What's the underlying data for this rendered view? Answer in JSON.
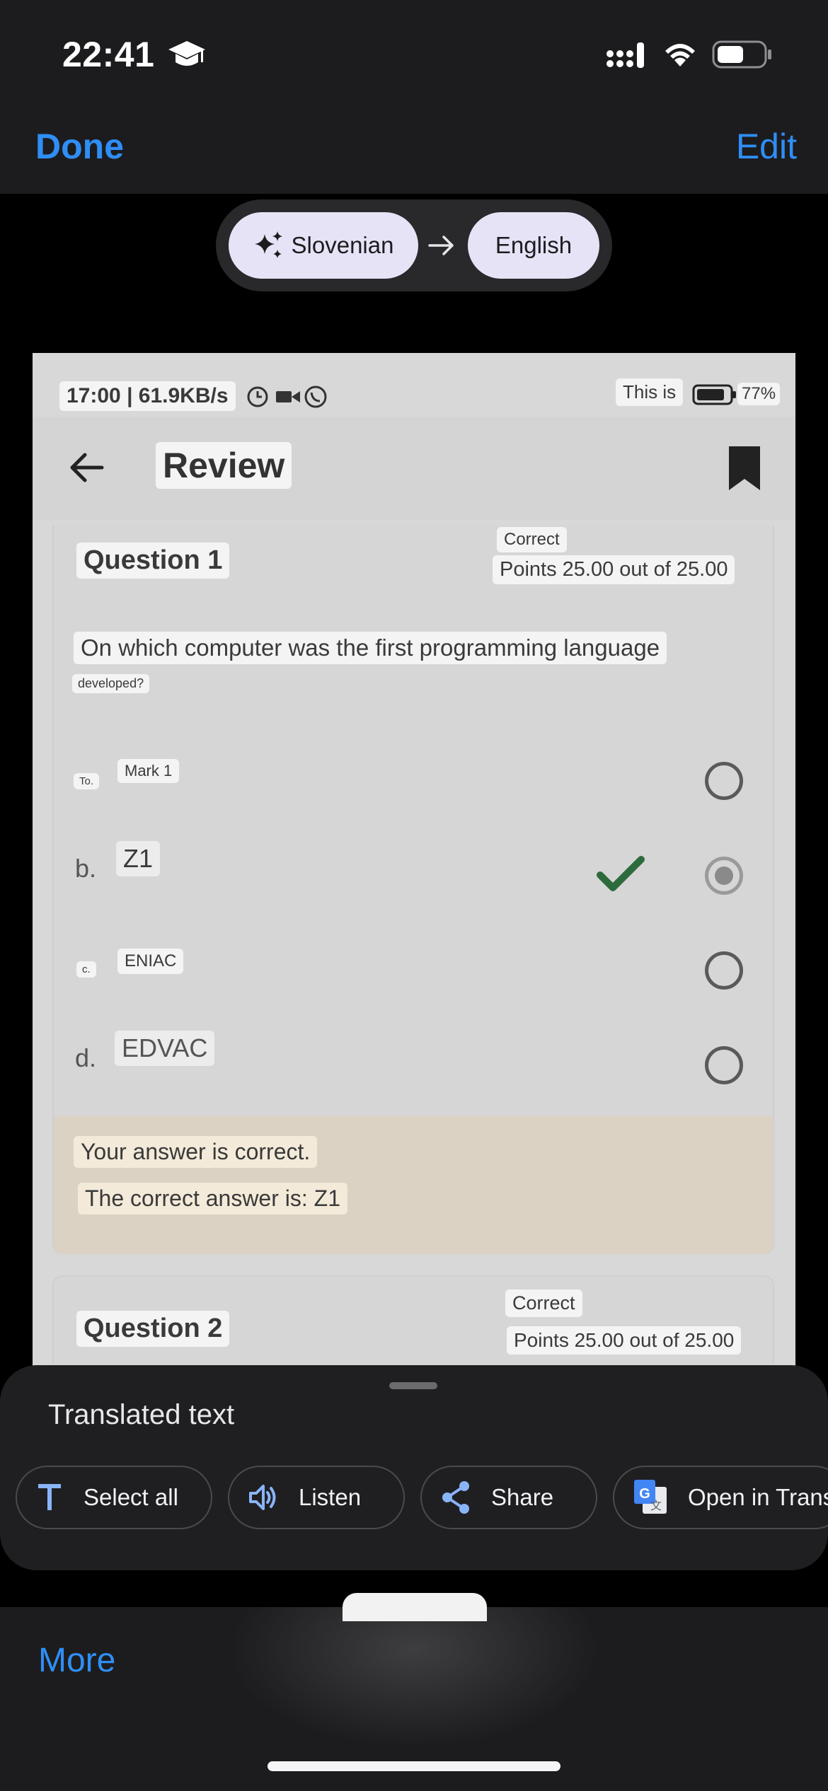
{
  "status_bar": {
    "time": "22:41"
  },
  "nav": {
    "done": "Done",
    "edit": "Edit"
  },
  "language": {
    "source": "Slovenian",
    "target": "English"
  },
  "image": {
    "status": {
      "time_speed": "17:00 | 61.9KB/s",
      "carrier": "This is",
      "battery": "77%"
    },
    "appbar": {
      "title": "Review"
    },
    "question1": {
      "title": "Question 1",
      "status": "Correct",
      "points": "Points 25.00 out of 25.00",
      "text_line1": "On which computer was the first programming language",
      "text_line2": "developed?",
      "options": [
        {
          "letter": "To.",
          "label": "Mark 1"
        },
        {
          "letter": "b.",
          "label": "Z1"
        },
        {
          "letter": "c.",
          "label": "ENIAC"
        },
        {
          "letter": "d.",
          "label": "EDVAC"
        }
      ],
      "feedback_line1": "Your answer is correct.",
      "feedback_line2": "The correct answer is: Z1"
    },
    "question2": {
      "title": "Question 2",
      "status": "Correct",
      "points": "Points 25.00 out of 25.00"
    }
  },
  "sheet": {
    "title": "Translated text",
    "actions": {
      "select_all": "Select all",
      "listen": "Listen",
      "share": "Share",
      "open_translate": "Open in Trans"
    }
  },
  "toolbar": {
    "more": "More"
  },
  "colors": {
    "accent": "#2f8ef5",
    "pill": "#e7e3f7",
    "check": "#2e6b3c",
    "feedback_bg": "#dcd2c4"
  }
}
